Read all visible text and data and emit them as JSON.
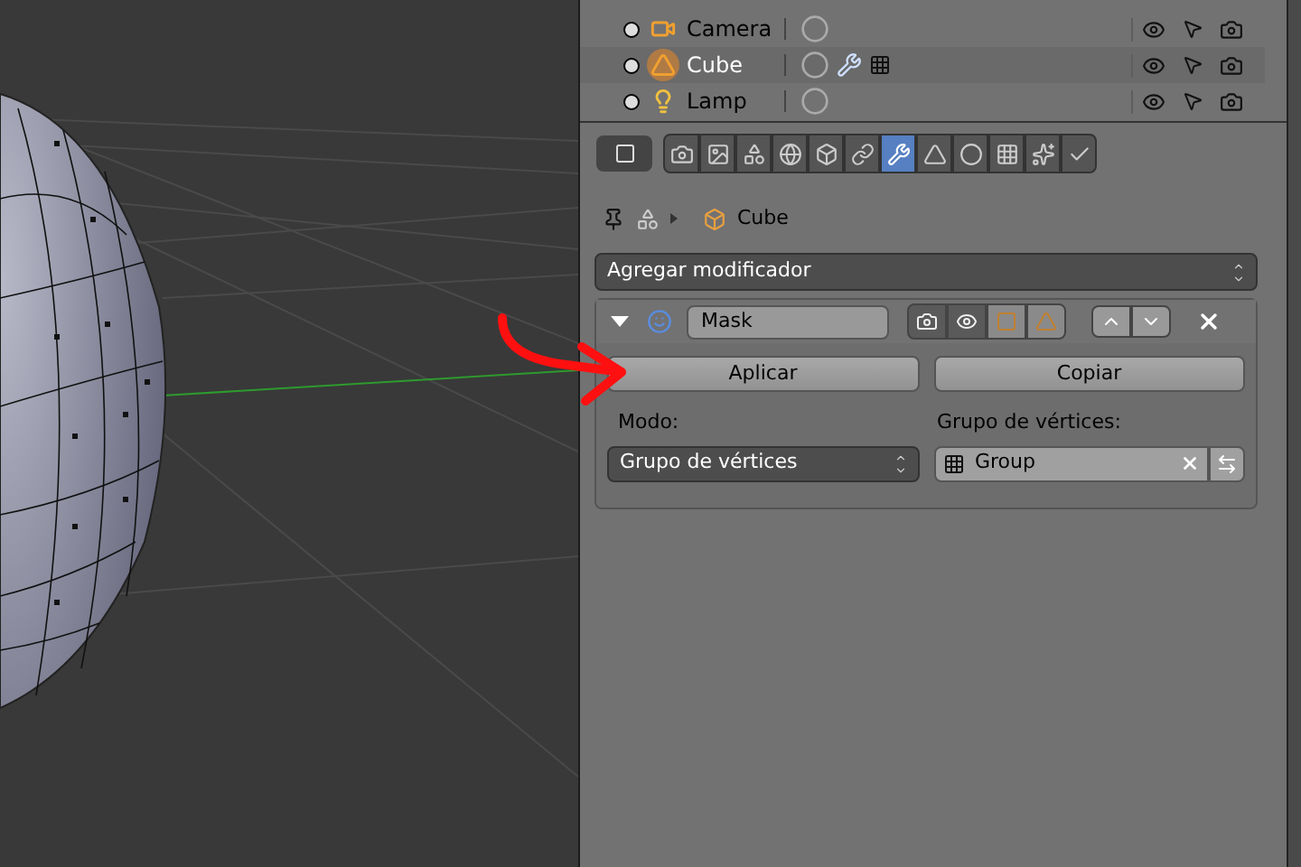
{
  "outliner": {
    "rows": [
      {
        "kind": "camera",
        "name": "Camera",
        "selected": false
      },
      {
        "kind": "mesh",
        "name": "Cube",
        "selected": true
      },
      {
        "kind": "lamp",
        "name": "Lamp",
        "selected": false
      }
    ]
  },
  "properties": {
    "tabs": [
      {
        "kind": "render",
        "selected": false
      },
      {
        "kind": "layers",
        "selected": false
      },
      {
        "kind": "scene",
        "selected": false
      },
      {
        "kind": "world",
        "selected": false
      },
      {
        "kind": "object",
        "selected": false
      },
      {
        "kind": "constraints",
        "selected": false
      },
      {
        "kind": "modifiers",
        "selected": true
      },
      {
        "kind": "data",
        "selected": false
      },
      {
        "kind": "material",
        "selected": false
      },
      {
        "kind": "texture",
        "selected": false
      },
      {
        "kind": "particles",
        "selected": false
      },
      {
        "kind": "physics",
        "selected": false
      }
    ],
    "breadcrumb": "Cube",
    "add_modifier": "Agregar modificador",
    "modifier": {
      "expanded": true,
      "name": "Mask",
      "toggles": [
        {
          "kind": "render",
          "on": true
        },
        {
          "kind": "viewport",
          "on": true
        },
        {
          "kind": "editmode",
          "on": false
        },
        {
          "kind": "cage",
          "on": false
        }
      ],
      "apply": "Aplicar",
      "copy": "Copiar",
      "mode_label": "Modo:",
      "mode_value": "Grupo de vértices",
      "group_label": "Grupo de vértices:",
      "group_value": "Group"
    }
  }
}
